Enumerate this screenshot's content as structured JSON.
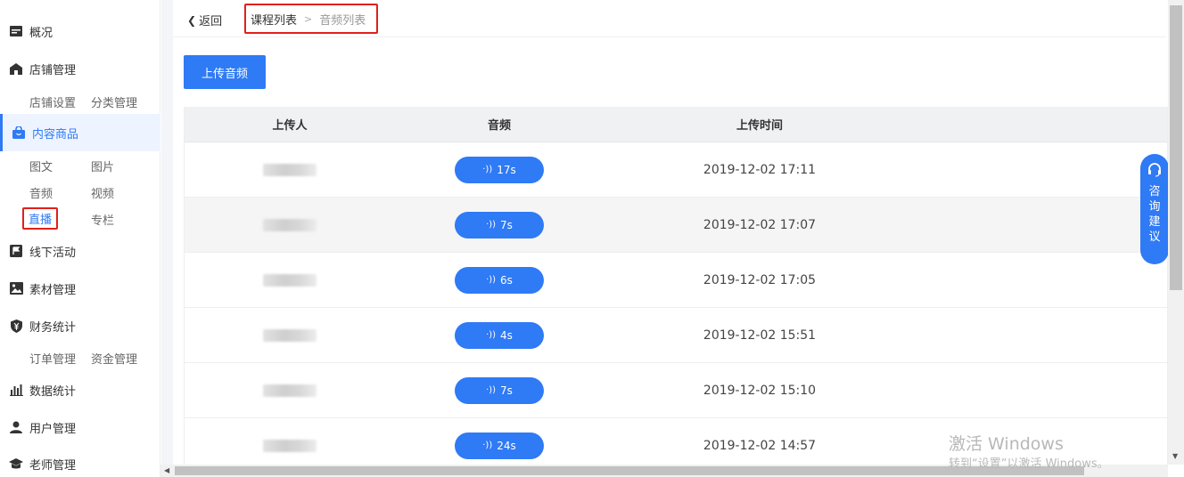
{
  "sidebar": {
    "items": [
      {
        "label": "概况",
        "icon": "overview-icon"
      },
      {
        "label": "店铺管理",
        "icon": "store-icon"
      },
      {
        "label": "内容商品",
        "icon": "bag-icon"
      },
      {
        "label": "线下活动",
        "icon": "flag-icon"
      },
      {
        "label": "素材管理",
        "icon": "image-icon"
      },
      {
        "label": "财务统计",
        "icon": "yuan-shield-icon"
      },
      {
        "label": "数据统计",
        "icon": "bar-chart-icon"
      },
      {
        "label": "用户管理",
        "icon": "user-icon"
      },
      {
        "label": "老师管理",
        "icon": "graduation-cap-icon"
      }
    ],
    "store_sub": [
      "店铺设置",
      "分类管理"
    ],
    "content_sub": [
      "图文",
      "图片",
      "音频",
      "视频",
      "直播",
      "专栏"
    ],
    "finance_sub": [
      "订单管理",
      "资金管理"
    ]
  },
  "header": {
    "back_label": "返回",
    "breadcrumb": [
      "课程列表",
      "音频列表"
    ]
  },
  "toolbar": {
    "upload_label": "上传音频"
  },
  "table": {
    "columns": [
      "上传人",
      "音频",
      "上传时间"
    ],
    "rows": [
      {
        "duration": "17s",
        "time": "2019-12-02 17:11"
      },
      {
        "duration": "7s",
        "time": "2019-12-02 17:07"
      },
      {
        "duration": "6s",
        "time": "2019-12-02 17:05"
      },
      {
        "duration": "4s",
        "time": "2019-12-02 15:51"
      },
      {
        "duration": "7s",
        "time": "2019-12-02 15:10"
      },
      {
        "duration": "24s",
        "time": "2019-12-02 14:57"
      }
    ]
  },
  "consult": {
    "label": "咨询建议"
  },
  "watermark": {
    "line1": "激活 Windows",
    "line2": "转到“设置”以激活 Windows。"
  },
  "colors": {
    "accent": "#2f7af5",
    "highlight": "#e0201b"
  }
}
